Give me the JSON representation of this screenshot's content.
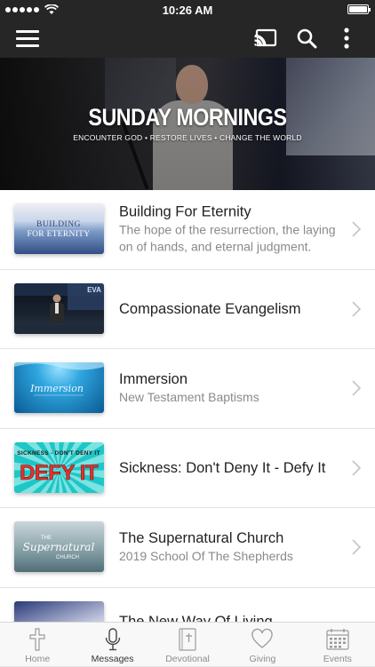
{
  "status_bar": {
    "time": "10:26 AM",
    "battery_level": 1.0,
    "signal_bars": 5
  },
  "app_bar": {
    "menu_icon": "hamburger-menu-icon",
    "cast_icon": "cast-icon",
    "search_icon": "search-icon",
    "more_icon": "more-vertical-icon"
  },
  "hero": {
    "title": "SUNDAY MORNINGS",
    "subtitle": "ENCOUNTER GOD • RESTORE LIVES • CHANGE THE WORLD"
  },
  "series": [
    {
      "title": "Building For Eternity",
      "subtitle": "The hope of the resurrection, the laying on of hands, and eternal judgment.",
      "thumb_text": "BUILDING FOR ETERNITY"
    },
    {
      "title": "Compassionate Evangelism",
      "subtitle": "",
      "thumb_text": "EVA"
    },
    {
      "title": "Immersion",
      "subtitle": "New Testament Baptisms",
      "thumb_text": "Immersion"
    },
    {
      "title": "Sickness: Don't Deny It - Defy It",
      "subtitle": "",
      "thumb_text_top": "SICKNESS - DON'T DENY IT",
      "thumb_text_main": "DEFY IT"
    },
    {
      "title": "The Supernatural Church",
      "subtitle": "2019 School Of The Shepherds",
      "thumb_text": "THE Supernatural CHURCH"
    },
    {
      "title": "The New Way Of Living",
      "subtitle": ""
    }
  ],
  "tabs": [
    {
      "label": "Home",
      "icon": "cross-icon",
      "active": false
    },
    {
      "label": "Messages",
      "icon": "microphone-icon",
      "active": true
    },
    {
      "label": "Devotional",
      "icon": "bible-icon",
      "active": false
    },
    {
      "label": "Giving",
      "icon": "heart-icon",
      "active": false
    },
    {
      "label": "Events",
      "icon": "calendar-icon",
      "active": false
    }
  ]
}
